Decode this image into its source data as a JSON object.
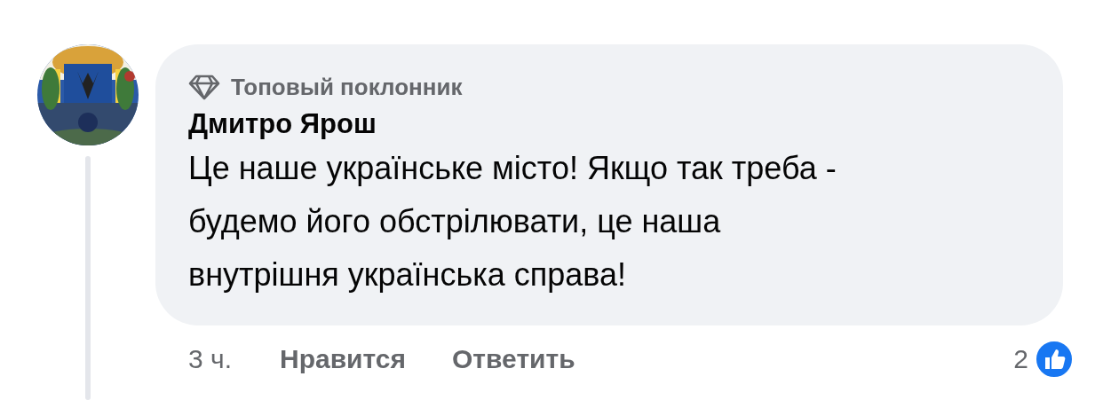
{
  "comment": {
    "badge": "Топовый поклонник",
    "author": "Дмитро Ярош",
    "text_lines": [
      "Це наше українське місто! Якщо так треба -",
      "будемо його обстрілювати, це наша",
      "внутрішня українська справа!"
    ],
    "time": "3 ч.",
    "actions": [
      "Нравится",
      "Ответить"
    ],
    "reactions_count": "2"
  }
}
